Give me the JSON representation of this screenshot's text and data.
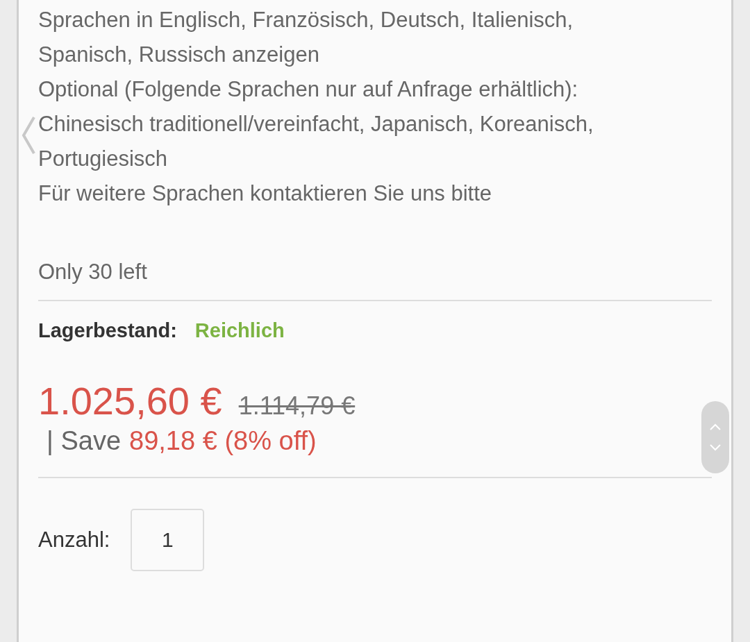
{
  "description": {
    "lines": [
      "Sprachen in Englisch, Französisch, Deutsch, Italienisch, Spanisch, Russisch anzeigen",
      "Optional (Folgende Sprachen nur auf Anfrage erhältlich):",
      "Chinesisch traditionell/vereinfacht, Japanisch, Koreanisch, Portugiesisch",
      "Für weitere Sprachen kontaktieren Sie uns bitte"
    ]
  },
  "stock_note": "Only 30 left",
  "stock": {
    "label": "Lagerbestand:",
    "value": "Reichlich",
    "color": "#7cb342"
  },
  "price": {
    "current": "1.025,60 €",
    "original": "1.114,79 €",
    "save_label": "| Save",
    "save_amount": "89,18 € (8% off)"
  },
  "quantity": {
    "label": "Anzahl:",
    "value": "1"
  }
}
